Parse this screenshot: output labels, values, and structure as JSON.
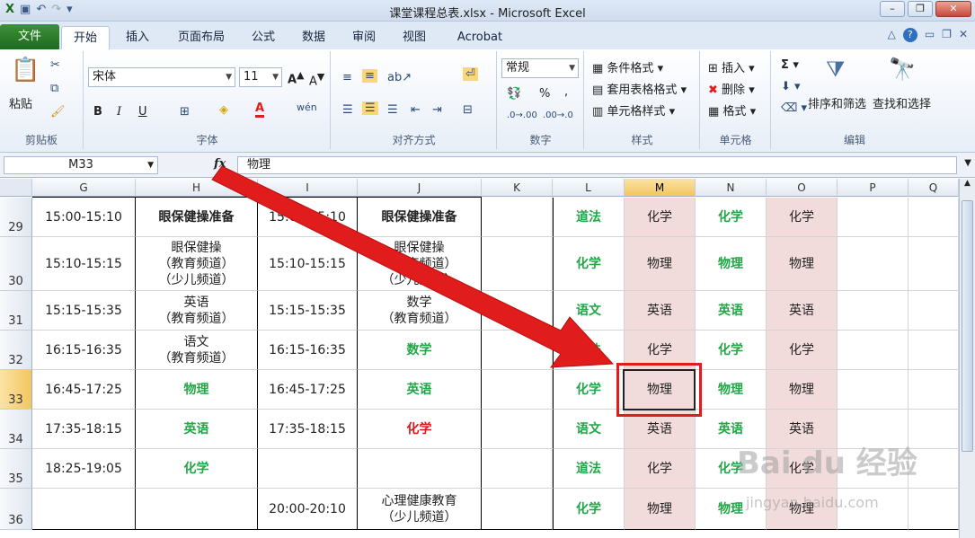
{
  "window": {
    "title": "课堂课程总表.xlsx  -  Microsoft Excel",
    "qat": [
      "save-icon",
      "undo-icon",
      "redo-icon",
      "customize-icon"
    ]
  },
  "tabs": [
    {
      "label": "文件"
    },
    {
      "label": "开始"
    },
    {
      "label": "插入"
    },
    {
      "label": "页面布局"
    },
    {
      "label": "公式"
    },
    {
      "label": "数据"
    },
    {
      "label": "审阅"
    },
    {
      "label": "视图"
    },
    {
      "label": "Acrobat"
    }
  ],
  "ribbon": {
    "clipboard": {
      "paste": "粘贴",
      "label": "剪贴板"
    },
    "font": {
      "name": "宋体",
      "size": "11",
      "label": "字体",
      "bold": "B",
      "italic": "I",
      "underline": "U"
    },
    "align": {
      "label": "对齐方式"
    },
    "number": {
      "format": "常规",
      "label": "数字",
      "percent": "%",
      "comma": ","
    },
    "styles": {
      "cond": "条件格式",
      "table": "套用表格格式",
      "cell": "单元格样式",
      "label": "样式"
    },
    "cells": {
      "insert": "插入",
      "delete": "删除",
      "format": "格式",
      "label": "单元格"
    },
    "editing": {
      "sort": "排序和筛选",
      "find": "查找和选择",
      "label": "编辑"
    }
  },
  "formula": {
    "namebox": "M33",
    "fx": "fx",
    "value": "物理"
  },
  "columns": [
    "G",
    "H",
    "I",
    "J",
    "K",
    "L",
    "M",
    "N",
    "O",
    "P",
    "Q"
  ],
  "selected_column": "M",
  "selected_row": "33",
  "rows": [
    {
      "num": "29",
      "G": "15:00-15:10",
      "H": "眼保健操准备",
      "I": "15:00-15:10",
      "J": "眼保健操准备",
      "L": "道法",
      "M": "化学",
      "N": "化学",
      "O": "化学"
    },
    {
      "num": "30",
      "G": "15:10-15:15",
      "H": "眼保健操\n（教育频道）\n（少儿频道）",
      "I": "15:10-15:15",
      "J": "眼保健操\n（教育频道）\n（少儿频道）",
      "L": "化学",
      "M": "物理",
      "N": "物理",
      "O": "物理"
    },
    {
      "num": "31",
      "G": "15:15-15:35",
      "H": "英语\n（教育频道）",
      "I": "15:15-15:35",
      "J": "数学\n（教育频道）",
      "L": "语文",
      "M": "英语",
      "N": "英语",
      "O": "英语"
    },
    {
      "num": "32",
      "G": "16:15-16:35",
      "H": "语文\n（教育频道）",
      "I": "16:15-16:35",
      "J": "数学",
      "L": "道法",
      "M": "化学",
      "N": "化学",
      "O": "化学"
    },
    {
      "num": "33",
      "G": "16:45-17:25",
      "H": "物理",
      "I": "16:45-17:25",
      "J": "英语",
      "L": "化学",
      "M": "物理",
      "N": "物理",
      "O": "物理"
    },
    {
      "num": "34",
      "G": "17:35-18:15",
      "H": "英语",
      "I": "17:35-18:15",
      "J": "化学",
      "L": "语文",
      "M": "英语",
      "N": "英语",
      "O": "英语"
    },
    {
      "num": "35",
      "G": "18:25-19:05",
      "H": "化学",
      "I": "",
      "J": "",
      "L": "道法",
      "M": "化学",
      "N": "化学",
      "O": "化学"
    },
    {
      "num": "36",
      "G": "",
      "H": "",
      "I": "20:00-20:10",
      "J": "心理健康教育\n（少儿频道）",
      "L": "化学",
      "M": "物理",
      "N": "物理",
      "O": "物理"
    }
  ],
  "colors": {
    "green": "#22a648",
    "red": "#e0161b",
    "pink": "#f2dcdb",
    "arrow": "#e01c1c"
  },
  "watermark": {
    "logo": "Bai du 经验",
    "url": "jingyan.baidu.com"
  }
}
